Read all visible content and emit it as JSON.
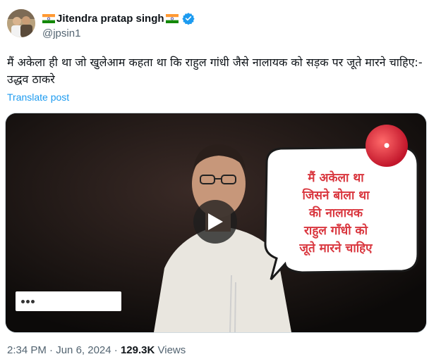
{
  "author": {
    "display_name": "Jitendra pratap singh",
    "handle": "@jpsin1",
    "verified": true,
    "flag_icon": "india-flag-icon"
  },
  "tweet": {
    "text": "मैं अकेला ही था जो खुलेआम कहता था कि राहुल गांधी जैसे नालायक को सड़क पर जूते मारने चाहिए:-  उद्धव ठाकरे",
    "translate_label": "Translate post"
  },
  "media": {
    "type": "video",
    "speech_bubble_lines": [
      "मैं अकेला था",
      "जिसने बोला था",
      "की नालायक",
      "राहुल गाँधी को",
      "जूते मारने चाहिए"
    ],
    "play_icon": "play-icon"
  },
  "meta": {
    "time": "2:34 PM",
    "date": "Jun 6, 2024",
    "views_count": "129.3K",
    "views_label": "Views",
    "separator": "·"
  },
  "colors": {
    "link": "#1d9bf0",
    "verified": "#1d9bf0",
    "muted": "#536471",
    "bubble_text": "#d9363e"
  }
}
